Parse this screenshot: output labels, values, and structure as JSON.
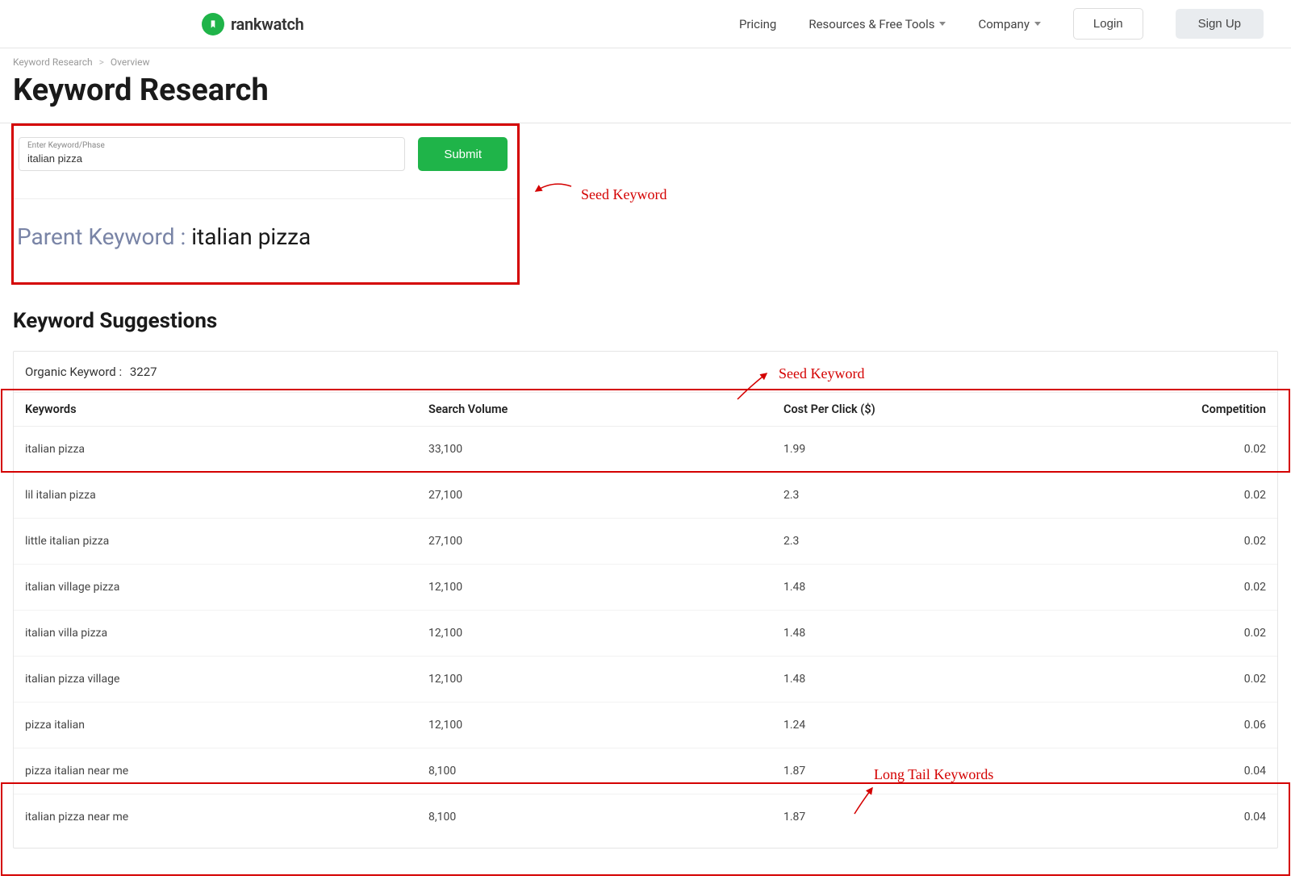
{
  "nav": {
    "brand": "rankwatch",
    "pricing": "Pricing",
    "resources": "Resources & Free Tools",
    "company": "Company",
    "login": "Login",
    "signup": "Sign Up"
  },
  "breadcrumb": {
    "item1": "Keyword Research",
    "sep": ">",
    "item2": "Overview"
  },
  "page": {
    "title": "Keyword Research"
  },
  "search": {
    "label": "Enter Keyword/Phase",
    "value": "italian pizza",
    "submit": "Submit"
  },
  "parent": {
    "label": "Parent Keyword : ",
    "value": "italian pizza"
  },
  "annotations": {
    "seed": "Seed Keyword",
    "longtail": "Long Tail Keywords"
  },
  "suggestions": {
    "title": "Keyword Suggestions",
    "organic_label": "Organic Keyword :",
    "organic_count": "3227",
    "headers": {
      "keywords": "Keywords",
      "search_volume": "Search Volume",
      "cpc": "Cost Per Click ($)",
      "competition": "Competition"
    },
    "rows": [
      {
        "kw": "italian pizza",
        "sv": "33,100",
        "cpc": "1.99",
        "comp": "0.02"
      },
      {
        "kw": "lil italian pizza",
        "sv": "27,100",
        "cpc": "2.3",
        "comp": "0.02"
      },
      {
        "kw": "little italian pizza",
        "sv": "27,100",
        "cpc": "2.3",
        "comp": "0.02"
      },
      {
        "kw": "italian village pizza",
        "sv": "12,100",
        "cpc": "1.48",
        "comp": "0.02"
      },
      {
        "kw": "italian villa pizza",
        "sv": "12,100",
        "cpc": "1.48",
        "comp": "0.02"
      },
      {
        "kw": "italian pizza village",
        "sv": "12,100",
        "cpc": "1.48",
        "comp": "0.02"
      },
      {
        "kw": "pizza italian",
        "sv": "12,100",
        "cpc": "1.24",
        "comp": "0.06"
      },
      {
        "kw": "pizza italian near me",
        "sv": "8,100",
        "cpc": "1.87",
        "comp": "0.04"
      },
      {
        "kw": "italian pizza near me",
        "sv": "8,100",
        "cpc": "1.87",
        "comp": "0.04"
      }
    ]
  }
}
